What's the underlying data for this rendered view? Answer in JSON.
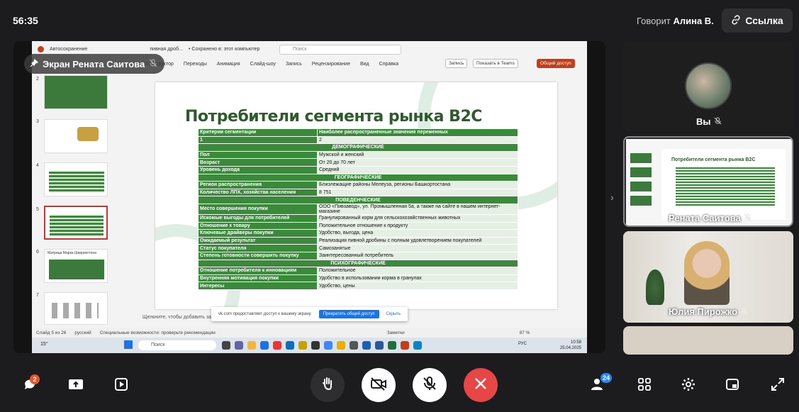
{
  "header": {
    "time": "56:35",
    "speaking_prefix": "Говорит",
    "speaking_name": "Алина В.",
    "link_label": "Ссылка"
  },
  "share": {
    "label": "Экран Рената Саитова"
  },
  "powerpoint": {
    "autosave": "Автосохранение",
    "file_name": "пивная дроб...",
    "saved_status": "• Сохранено в: этот компьютер",
    "search_placeholder": "Поиск",
    "menu": [
      "Конструктор",
      "Переходы",
      "Анимация",
      "Слайд-шоу",
      "Запись",
      "Рецензирование",
      "Вид",
      "Справка"
    ],
    "record_label": "Запись",
    "teams_label": "Показать в Teams",
    "share_label": "Общий доступ",
    "thumbnails": [
      {
        "num": "2",
        "title": ""
      },
      {
        "num": "3",
        "title": ""
      },
      {
        "num": "4",
        "title": ""
      },
      {
        "num": "5",
        "title": ""
      },
      {
        "num": "6",
        "title": "Матрица Марка Шеррингтона"
      },
      {
        "num": "7",
        "title": ""
      }
    ],
    "slide": {
      "title": "Потребители сегмента рынка B2C",
      "columns": [
        "Критерии сегментации",
        "Наиболее распространенные значения переменных"
      ],
      "rows": [
        {
          "type": "row",
          "c1": "1",
          "c2": "2"
        },
        {
          "type": "section",
          "text": "ДЕМОГРАФИЧЕСКИЕ"
        },
        {
          "type": "row",
          "c1": "Пол",
          "c2": "Мужской и женский"
        },
        {
          "type": "row",
          "c1": "Возраст",
          "c2": "От 20 до 70 лет"
        },
        {
          "type": "row",
          "c1": "Уровень дохода",
          "c2": "Средний"
        },
        {
          "type": "section",
          "text": "ГЕОГРАФИЧЕСКИЕ"
        },
        {
          "type": "row",
          "c1": "Регион распространения",
          "c2": "Близлежащие районы Мелеуза, регионы Башкортостана"
        },
        {
          "type": "row",
          "c1": "Количество ЛПХ, хозяйства населения",
          "c2": "8 751"
        },
        {
          "type": "section",
          "text": "ПОВЕДЕНЧЕСКИЕ"
        },
        {
          "type": "row",
          "c1": "Место совершения покупки",
          "c2": "ООО «Пивзавод», ул. Промышленная 5а, а также на сайте в нашем интернет-магазине"
        },
        {
          "type": "row",
          "c1": "Искомые выгоды для потребителей",
          "c2": "Гранулированный корм для сельскохозяйственных животных"
        },
        {
          "type": "row",
          "c1": "Отношение к товару",
          "c2": "Положительное отношение к продукту"
        },
        {
          "type": "row",
          "c1": "Ключевые драйверы покупки",
          "c2": "Удобство, выгода, цена"
        },
        {
          "type": "row",
          "c1": "Ожидаемый результат",
          "c2": "Реализация пивной дробины с полным удовлетворением покупателей"
        },
        {
          "type": "row",
          "c1": "Статус покупателя",
          "c2": "Самозанятые"
        },
        {
          "type": "row",
          "c1": "Степень готовности совершить покупку",
          "c2": "Заинтересованный потребитель"
        },
        {
          "type": "section",
          "text": "ПСИХОГРАФИЧЕСКИЕ"
        },
        {
          "type": "row",
          "c1": "Отношение потребителя к инновациям",
          "c2": "Положительное"
        },
        {
          "type": "row",
          "c1": "Внутренняя мотивация покупки",
          "c2": "Удобство в использовании корма в гранулах"
        },
        {
          "type": "row",
          "c1": "Интересы",
          "c2": "Удобство, цены"
        }
      ]
    },
    "notes_placeholder": "Щелкните, чтобы добавить заметки",
    "status_slide": "Слайд 5 из 26",
    "status_lang": "русский",
    "status_access": "Специальные возможности: проверьте рекомендации",
    "status_notes": "Заметки",
    "status_zoom": "87 %",
    "notify_text": "vk.com предоставляет доступ к вашему экрану.",
    "notify_stop": "Прекратить общий доступ",
    "notify_hide": "Скрыть"
  },
  "taskbar": {
    "weather": "15°",
    "search": "Поиск",
    "lang": "РУС",
    "time": "10:58",
    "date": "25.04.2025"
  },
  "participants": [
    {
      "name": "Вы"
    },
    {
      "name": "Рената Саитова"
    },
    {
      "name": "Юлия Пирожко"
    }
  ],
  "controls": {
    "chat_badge": "2",
    "participants_badge": "24"
  },
  "colors": {
    "accent_red": "#e64646",
    "slide_green": "#3b8a3b",
    "badge_orange": "#e4572e",
    "badge_blue": "#2787f5"
  }
}
